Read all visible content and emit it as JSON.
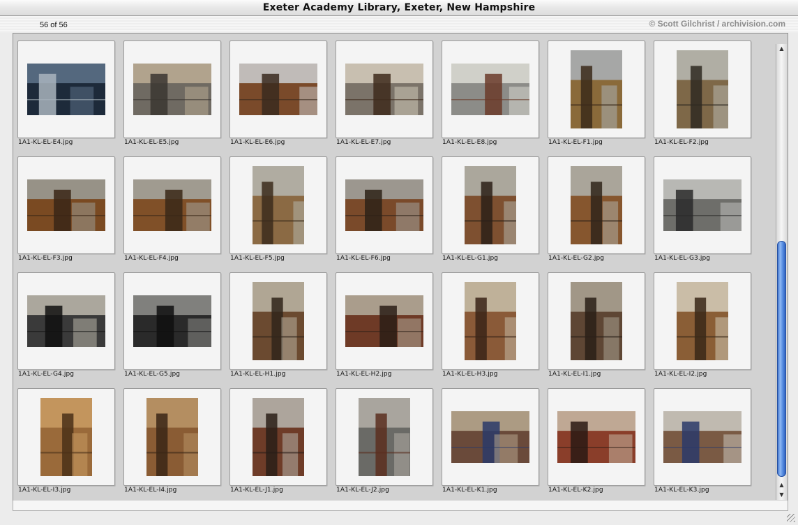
{
  "window": {
    "title": "Exeter Academy Library, Exeter, New Hampshire",
    "count": "56 of 56",
    "credit": "© Scott Gilchrist / archivision.com"
  },
  "icons": {
    "scroll_up": "arrow-up-icon",
    "scroll_down": "arrow-down-icon",
    "resize": "resize-grip-icon"
  },
  "files": [
    "1A1-KL-EL-E4.jpg",
    "1A1-KL-EL-E5.jpg",
    "1A1-KL-EL-E6.jpg",
    "1A1-KL-EL-E7.jpg",
    "1A1-KL-EL-E8.jpg",
    "1A1-KL-EL-F1.jpg",
    "1A1-KL-EL-F2.jpg",
    "1A1-KL-EL-F3.jpg",
    "1A1-KL-EL-F4.jpg",
    "1A1-KL-EL-F5.jpg",
    "1A1-KL-EL-F6.jpg",
    "1A1-KL-EL-G1.jpg",
    "1A1-KL-EL-G2.jpg",
    "1A1-KL-EL-G3.jpg",
    "1A1-KL-EL-G4.jpg",
    "1A1-KL-EL-G5.jpg",
    "1A1-KL-EL-H1.jpg",
    "1A1-KL-EL-H2.jpg",
    "1A1-KL-EL-H3.jpg",
    "1A1-KL-EL-I1.jpg",
    "1A1-KL-EL-I2.jpg",
    "1A1-KL-EL-I3.jpg",
    "1A1-KL-EL-I4.jpg",
    "1A1-KL-EL-J1.jpg",
    "1A1-KL-EL-J2.jpg",
    "1A1-KL-EL-K1.jpg",
    "1A1-KL-EL-K2.jpg",
    "1A1-KL-EL-K3.jpg"
  ],
  "orientation": [
    "landscape",
    "landscape",
    "landscape",
    "landscape",
    "landscape",
    "portrait",
    "portrait",
    "landscape",
    "landscape",
    "portrait",
    "landscape",
    "portrait",
    "portrait",
    "landscape",
    "landscape",
    "landscape",
    "portrait",
    "landscape",
    "portrait",
    "portrait",
    "portrait",
    "portrait",
    "portrait",
    "portrait",
    "portrait",
    "landscape",
    "landscape",
    "landscape"
  ],
  "palettes": [
    [
      "#1d2a3a",
      "#5b6f86",
      "#a9b4bd"
    ],
    [
      "#6f6a62",
      "#b8aa92",
      "#3b3631"
    ],
    [
      "#7a4a2a",
      "#c8c8c8",
      "#3a2a1e"
    ],
    [
      "#7b7369",
      "#d0c8b8",
      "#3e2a1c"
    ],
    [
      "#8c8c88",
      "#d7d7d0",
      "#6b3b2a"
    ],
    [
      "#8a6a3a",
      "#a9aeb2",
      "#3b2a1a"
    ],
    [
      "#7e6848",
      "#b6b6ae",
      "#2f2a22"
    ],
    [
      "#7a4a22",
      "#9a9a92",
      "#3a2616"
    ],
    [
      "#805028",
      "#a3a39b",
      "#3a2818"
    ],
    [
      "#8b6a44",
      "#b4b4ac",
      "#3c2c1c"
    ],
    [
      "#7a4a2a",
      "#a0a09a",
      "#2e2218"
    ],
    [
      "#7e5030",
      "#b0b0a8",
      "#2c2018"
    ],
    [
      "#86562e",
      "#aeaea6",
      "#30241a"
    ],
    [
      "#6e6e6a",
      "#c0c0bc",
      "#2a2a2a"
    ],
    [
      "#3a3a3a",
      "#b8b4a8",
      "#111111"
    ],
    [
      "#2a2a2a",
      "#8a8a86",
      "#0f0f0f"
    ],
    [
      "#6b4a30",
      "#b8b0a0",
      "#30241a"
    ],
    [
      "#6e3a26",
      "#b0a898",
      "#2c1e16"
    ],
    [
      "#8a5a38",
      "#c4baa4",
      "#3a2418"
    ],
    [
      "#5e4634",
      "#a8a090",
      "#2a2018"
    ],
    [
      "#8a5e36",
      "#d0c8b4",
      "#3a2818"
    ],
    [
      "#9a6a3a",
      "#c89a62",
      "#4a3018"
    ],
    [
      "#8a5c34",
      "#b89466",
      "#3a2616"
    ],
    [
      "#6e3c28",
      "#b4b0a8",
      "#2a1e18"
    ],
    [
      "#6a6a66",
      "#b0aca4",
      "#5a2e1e"
    ],
    [
      "#6a4a3a",
      "#b4a48c",
      "#2a3a6a"
    ],
    [
      "#8a3e2a",
      "#c4b4a0",
      "#2a1a14"
    ],
    [
      "#7a5a44",
      "#c8c4bc",
      "#2a3a6a"
    ]
  ]
}
